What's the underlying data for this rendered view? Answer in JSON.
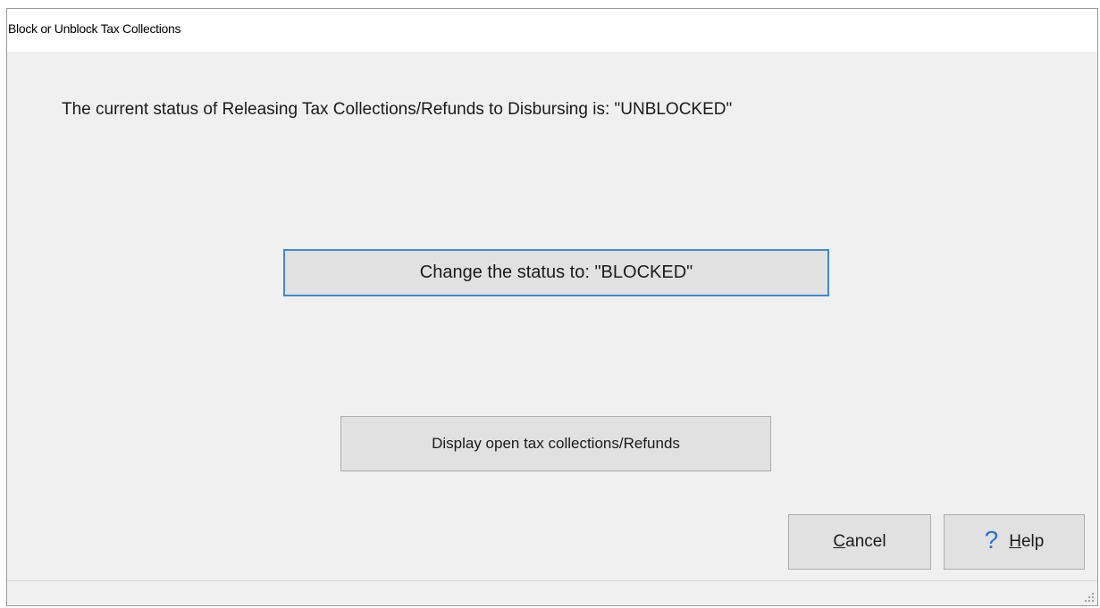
{
  "window": {
    "title": "Block or Unblock Tax Collections"
  },
  "main": {
    "status_text": "The current status of Releasing Tax Collections/Refunds to Disbursing is: \"UNBLOCKED\"",
    "change_button_label": "Change the status to: \"BLOCKED\"",
    "display_button_label": "Display open tax collections/Refunds"
  },
  "footer": {
    "cancel_mnemonic": "C",
    "cancel_rest": "ancel",
    "help_icon_glyph": "?",
    "help_icon_name": "question-mark-icon",
    "help_mnemonic": "H",
    "help_rest": "elp"
  },
  "colors": {
    "dialog_background": "#f0f0f0",
    "title_background": "#ffffff",
    "button_face": "#e1e1e1",
    "focus_border": "#3f8ad0",
    "help_icon": "#2b6fd6"
  }
}
